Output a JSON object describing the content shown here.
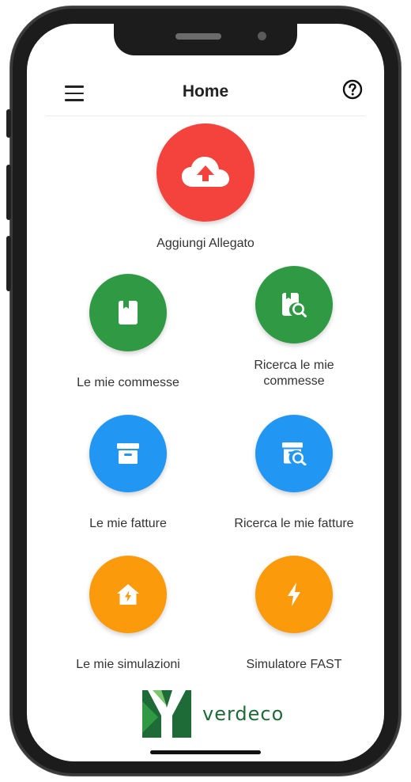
{
  "header": {
    "title": "Home",
    "menu_icon": "hamburger-menu-icon",
    "help_icon": "help-circle-icon"
  },
  "tiles": {
    "add_attachment": {
      "label": "Aggiungi Allegato",
      "icon": "cloud-upload-icon",
      "color": "#f4433c"
    },
    "my_orders": {
      "label": "Le mie commesse",
      "icon": "bookmark-document-icon",
      "color": "#2f9a43"
    },
    "search_orders": {
      "label_line1": "Ricerca le mie",
      "label_line2": "commesse",
      "icon": "document-search-icon",
      "color": "#2f9a43"
    },
    "my_invoices": {
      "label": "Le mie fatture",
      "icon": "archive-box-icon",
      "color": "#2196f3"
    },
    "search_invoices": {
      "label": "Ricerca le mie fatture",
      "icon": "archive-search-icon",
      "color": "#2196f3"
    },
    "my_simulations": {
      "label": "Le mie simulazioni",
      "icon": "home-energy-icon",
      "color": "#fb9a0a"
    },
    "fast_simulator": {
      "label": "Simulatore FAST",
      "icon": "lightning-bolt-icon",
      "color": "#fb9a0a"
    }
  },
  "brand": {
    "name": "verdeco",
    "color": "#1e6b38"
  }
}
